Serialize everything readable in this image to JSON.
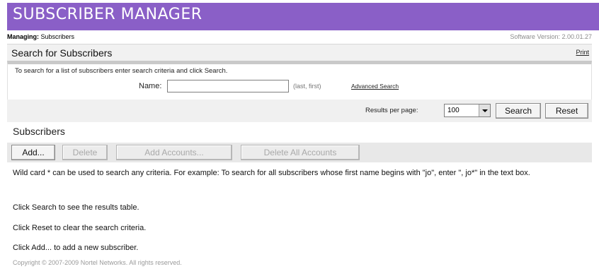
{
  "app": {
    "title": "SUBSCRIBER MANAGER",
    "managing_label": "Managing:",
    "managing_value": "Subscribers",
    "version": "Software Version: 2.00.01.27"
  },
  "search": {
    "title": "Search for Subscribers",
    "print_label": "Print",
    "instructions": "To search for a list of subscribers enter search criteria and click Search.",
    "name_label": "Name:",
    "name_value": "",
    "name_hint": "(last, first)",
    "advanced_label": "Advanced Search",
    "results_per_page_label": "Results per page:",
    "results_per_page_value": "100",
    "search_button": "Search",
    "reset_button": "Reset"
  },
  "subscribers": {
    "title": "Subscribers",
    "add_button": "Add...",
    "delete_button": "Delete",
    "add_accounts_button": "Add Accounts...",
    "delete_all_button": "Delete All Accounts"
  },
  "help": {
    "wildcard": "Wild card * can be used to search any criteria. For example: To search for all subscribers whose first name begins with \"jo\", enter \", jo*\" in the text box.",
    "search_tip": "Click Search to see the results table.",
    "reset_tip": "Click Reset to clear the search criteria.",
    "add_tip": "Click Add... to add a new subscriber."
  },
  "footer": {
    "copyright": "Copyright © 2007-2009 Nortel Networks. All rights reserved."
  }
}
